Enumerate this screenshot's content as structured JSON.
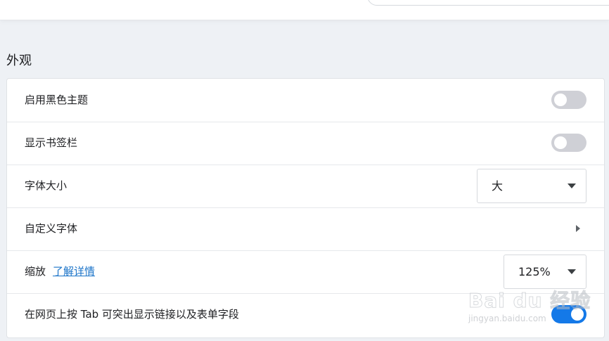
{
  "section": {
    "title": "外观"
  },
  "settings": {
    "dark_theme": {
      "label": "启用黑色主题",
      "enabled": false
    },
    "bookmarks_bar": {
      "label": "显示书签栏",
      "enabled": false
    },
    "font_size": {
      "label": "字体大小",
      "value": "大"
    },
    "custom_fonts": {
      "label": "自定义字体"
    },
    "zoom": {
      "label": "缩放",
      "link": "了解详情",
      "value": "125%"
    },
    "tab_highlight": {
      "label": "在网页上按 Tab 可突出显示链接以及表单字段",
      "enabled": true
    }
  },
  "watermark": {
    "main": "Bai du 经验",
    "sub": "jingyan.baidu.com"
  },
  "colors": {
    "accent": "#1479e8",
    "link": "#1a73c8",
    "toggle_off": "#cfd0d6"
  }
}
